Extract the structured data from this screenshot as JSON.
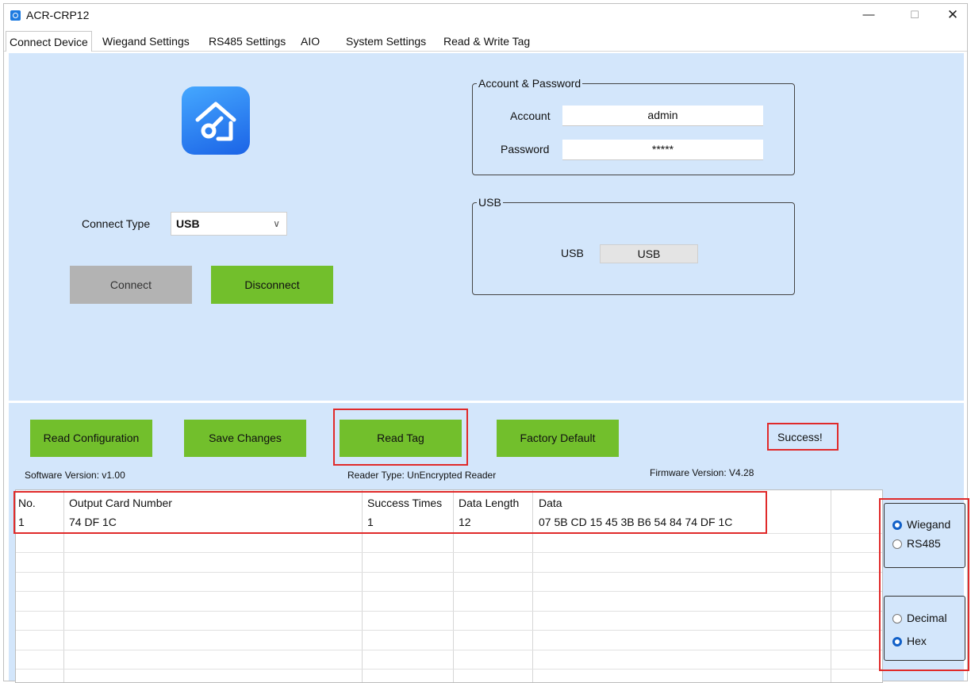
{
  "window": {
    "title": "ACR-CRP12"
  },
  "tabs": [
    {
      "label": "Connect Device"
    },
    {
      "label": "Wiegand Settings"
    },
    {
      "label": "RS485 Settings"
    },
    {
      "label": "AIO"
    },
    {
      "label": "System Settings"
    },
    {
      "label": "Read & Write Tag"
    }
  ],
  "connect": {
    "type_label": "Connect Type",
    "type_value": "USB",
    "connect_label": "Connect",
    "disconnect_label": "Disconnect"
  },
  "account": {
    "legend": "Account & Password",
    "account_label": "Account",
    "account_value": "admin",
    "password_label": "Password",
    "password_value": "*****"
  },
  "usb": {
    "legend": "USB",
    "label": "USB",
    "button_label": "USB"
  },
  "actions": {
    "read_config": "Read Configuration",
    "save_changes": "Save Changes",
    "read_tag": "Read Tag",
    "factory_default": "Factory Default",
    "status": "Success!"
  },
  "info": {
    "software_version": "Software Version:   v1.00",
    "reader_type": "Reader Type:  UnEncrypted Reader",
    "firmware_version": "Firmware Version:   V4.28"
  },
  "table": {
    "headers": [
      "No.",
      "Output Card Number",
      "Success Times",
      "Data Length",
      "Data"
    ],
    "rows": [
      [
        "1",
        "74 DF 1C",
        "1",
        "12",
        "07 5B CD 15 45 3B B6 54 84 74 DF 1C"
      ]
    ]
  },
  "output_mode": {
    "options": [
      "Wiegand",
      "RS485"
    ],
    "selected": "Wiegand"
  },
  "number_format": {
    "options": [
      "Decimal",
      "Hex"
    ],
    "selected": "Hex"
  },
  "colors": {
    "panel": "#d3e6fb",
    "button_green": "#72bf2c",
    "highlight_red": "#e02a2a"
  }
}
